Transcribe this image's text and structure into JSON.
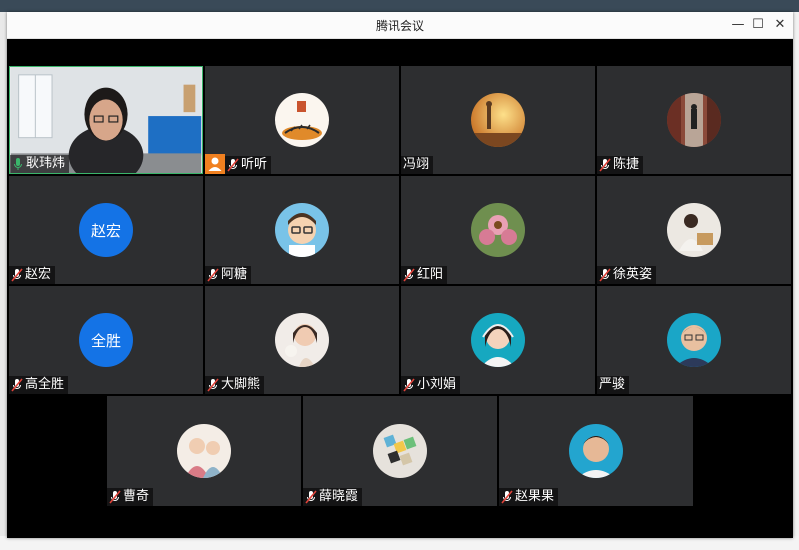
{
  "window": {
    "title": "腾讯会议"
  },
  "controls": {
    "minimize": "—",
    "maximize": "☐",
    "close": "✕"
  },
  "participants": [
    {
      "name": "耿玮炜",
      "muted": false,
      "camera": true,
      "avatar": "video-feed"
    },
    {
      "name": "听听",
      "muted": true,
      "host": true,
      "avatar": "tiger-art"
    },
    {
      "name": "冯翊",
      "muted": false,
      "avatar": "sunset-photo"
    },
    {
      "name": "陈捷",
      "muted": true,
      "avatar": "street-photo"
    },
    {
      "name": "赵宏",
      "muted": true,
      "avatar_text": "赵宏"
    },
    {
      "name": "阿糖",
      "muted": true,
      "avatar": "cartoon-boy"
    },
    {
      "name": "红阳",
      "muted": true,
      "avatar": "flower-photo"
    },
    {
      "name": "徐英姿",
      "muted": true,
      "avatar": "woman-photo"
    },
    {
      "name": "高全胜",
      "muted": true,
      "avatar_text": "全胜"
    },
    {
      "name": "大脚熊",
      "muted": true,
      "avatar": "woman-flower-photo"
    },
    {
      "name": "小刘娟",
      "muted": true,
      "avatar": "woman-headset-photo"
    },
    {
      "name": "严骏",
      "muted": false,
      "avatar": "man-portrait"
    },
    {
      "name": "曹奇",
      "muted": true,
      "avatar": "kids-photo"
    },
    {
      "name": "薛晓霞",
      "muted": true,
      "avatar": "blocks-photo"
    },
    {
      "name": "赵果果",
      "muted": true,
      "avatar": "man-photo"
    }
  ],
  "colors": {
    "tile": "#2d2e30",
    "accent": "#1473e6",
    "active_speaker": "#3bb56b",
    "host_badge": "#f08020",
    "muted": "#e0433a"
  }
}
